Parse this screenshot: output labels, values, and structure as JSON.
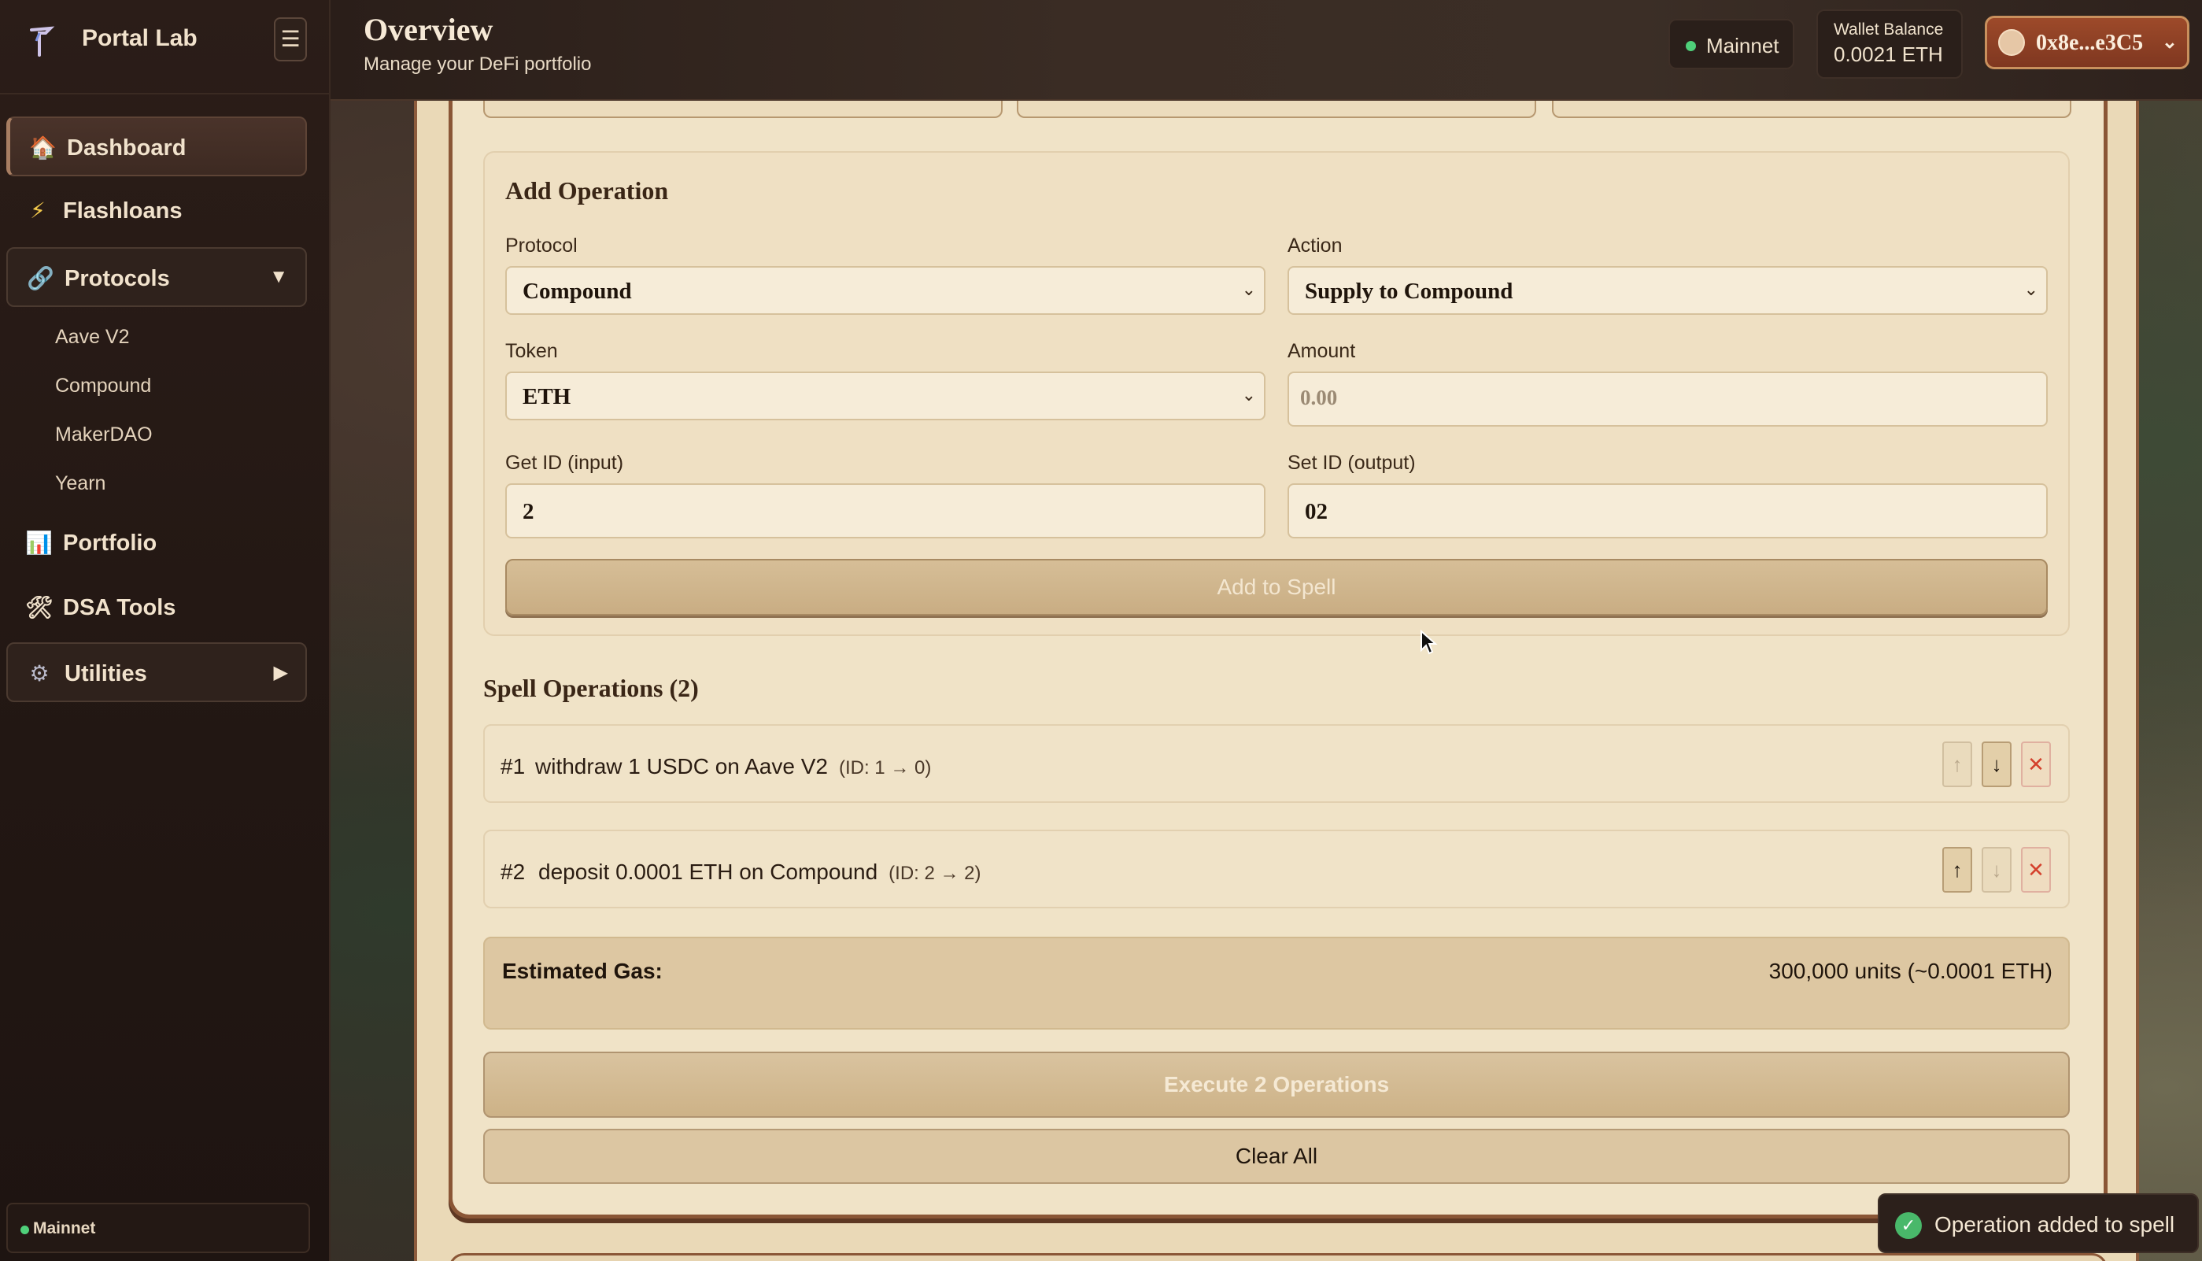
{
  "sidebar": {
    "brand": "Portal Lab",
    "menu_icon": "☰",
    "items": [
      {
        "label": "Dashboard",
        "icon": "home-icon"
      },
      {
        "label": "Flashloans",
        "icon": "lightning-icon"
      },
      {
        "label": "Protocols",
        "icon": "link-icon",
        "chevron": "▼"
      },
      {
        "label": "Portfolio",
        "icon": "bar-chart-icon"
      },
      {
        "label": "DSA Tools",
        "icon": "tools-icon"
      },
      {
        "label": "Utilities",
        "icon": "gear-icon",
        "chevron": "▶"
      }
    ],
    "protocols": [
      "Aave V2",
      "Compound",
      "MakerDAO",
      "Yearn"
    ],
    "footer_network": "Mainnet"
  },
  "header": {
    "title": "Overview",
    "subtitle": "Manage your DeFi portfolio",
    "network": "Mainnet",
    "wallet_label": "Wallet Balance",
    "wallet_value": "0.0021 ETH",
    "account": "0x8e...e3C5"
  },
  "add_operation": {
    "title": "Add Operation",
    "protocol_label": "Protocol",
    "protocol_value": "Compound",
    "action_label": "Action",
    "action_value": "Supply to Compound",
    "token_label": "Token",
    "token_value": "ETH",
    "amount_label": "Amount",
    "amount_placeholder": "0.00",
    "get_id_label": "Get ID (input)",
    "get_id_value": "2",
    "set_id_label": "Set ID (output)",
    "set_id_value": "02",
    "add_button": "Add to Spell"
  },
  "spell": {
    "title": "Spell Operations (2)",
    "operations": [
      {
        "num": "#1",
        "desc": "withdraw 1 USDC on Aave V2",
        "ids": "(ID: 1 → 0)"
      },
      {
        "num": "#2",
        "desc": "deposit 0.0001 ETH on Compound",
        "ids": "(ID: 2 → 2)"
      }
    ],
    "gas_label": "Estimated Gas:",
    "gas_value": "300,000 units (~0.0001 ETH)",
    "execute_button": "Execute 2 Operations",
    "clear_button": "Clear All"
  },
  "toast": {
    "message": "Operation added to spell"
  },
  "colors": {
    "accent": "#8a5636",
    "parchment": "#f0e3c7",
    "success": "#49b86a",
    "danger": "#d4402c"
  }
}
